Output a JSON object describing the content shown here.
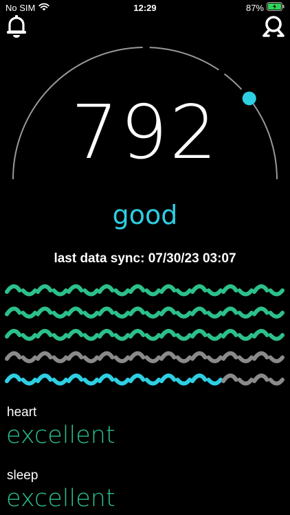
{
  "status_bar": {
    "carrier": "No SIM",
    "time": "12:29",
    "battery": "87%",
    "battery_level": 0.87
  },
  "gauge": {
    "score": "792",
    "rating": "good",
    "level_fraction": 0.79,
    "accent_color": "#2ecfe3",
    "track_color": "#9a9a9a"
  },
  "sync": {
    "text": "last data sync: 07/30/23 03:07"
  },
  "waves": {
    "colors": {
      "green": "#2cc08a",
      "gray": "#8a8a8a",
      "cyan": "#2ecfe3"
    },
    "rows": [
      [
        "green",
        "green",
        "green",
        "green",
        "green",
        "green",
        "green",
        "green",
        "green"
      ],
      [
        "green",
        "green",
        "green",
        "green",
        "green",
        "green",
        "green",
        "green",
        "green"
      ],
      [
        "green",
        "green",
        "green",
        "green",
        "green",
        "green",
        "green",
        "green",
        "green"
      ],
      [
        "gray",
        "gray",
        "gray",
        "gray",
        "gray",
        "gray",
        "gray",
        "gray",
        "gray"
      ],
      [
        "cyan",
        "cyan",
        "cyan",
        "cyan",
        "cyan",
        "cyan",
        "cyan",
        "gray",
        "gray"
      ]
    ]
  },
  "metrics": [
    {
      "label": "heart",
      "value": "excellent"
    },
    {
      "label": "sleep",
      "value": "excellent"
    }
  ],
  "icons": {
    "bell": "bell-icon",
    "profile": "profile-icon",
    "wifi": "wifi-icon",
    "battery": "battery-icon"
  }
}
